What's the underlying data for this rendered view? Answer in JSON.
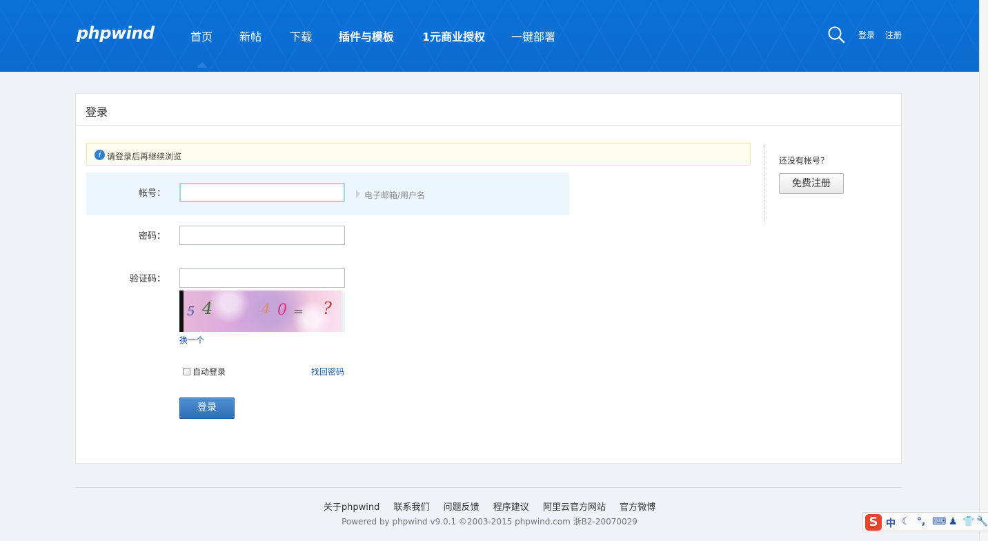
{
  "header": {
    "logo": "phpwind",
    "nav": [
      "首页",
      "新帖",
      "下载",
      "插件与模板",
      "1元商业授权",
      "一键部署"
    ],
    "login": "登录",
    "register": "注册"
  },
  "panel": {
    "title": "登录",
    "notice": "请登录后再继续浏览",
    "account_label": "帐号：",
    "account_value": "",
    "account_hint": "电子邮箱/用户名",
    "password_label": "密码：",
    "password_value": "",
    "captcha_label": "验证码：",
    "captcha_value": "",
    "captcha_chars": [
      "5",
      "4",
      "4",
      "0",
      "=",
      "?"
    ],
    "change_captcha": "换一个",
    "auto_login": "自动登录",
    "auto_login_checked": false,
    "forgot_password": "找回密码",
    "submit": "登录"
  },
  "side": {
    "question": "还没有帐号？",
    "register_button": "免费注册"
  },
  "footer": {
    "links": [
      "关于phpwind",
      "联系我们",
      "问题反馈",
      "程序建议",
      "阿里云官方网站",
      "官方微博"
    ],
    "powered": "Powered by phpwind v9.0.1 ©2003-2015 phpwind.com 浙B2-20070029"
  },
  "ime": {
    "logo": "S",
    "mode": "中",
    "items": [
      "☾",
      "°,",
      "⌨",
      "♟",
      "👕",
      "🔧"
    ]
  },
  "colors": {
    "header_blue": "#0b6fd4",
    "link_blue": "#1a5aa5",
    "button_blue": "#2f6fb6"
  }
}
